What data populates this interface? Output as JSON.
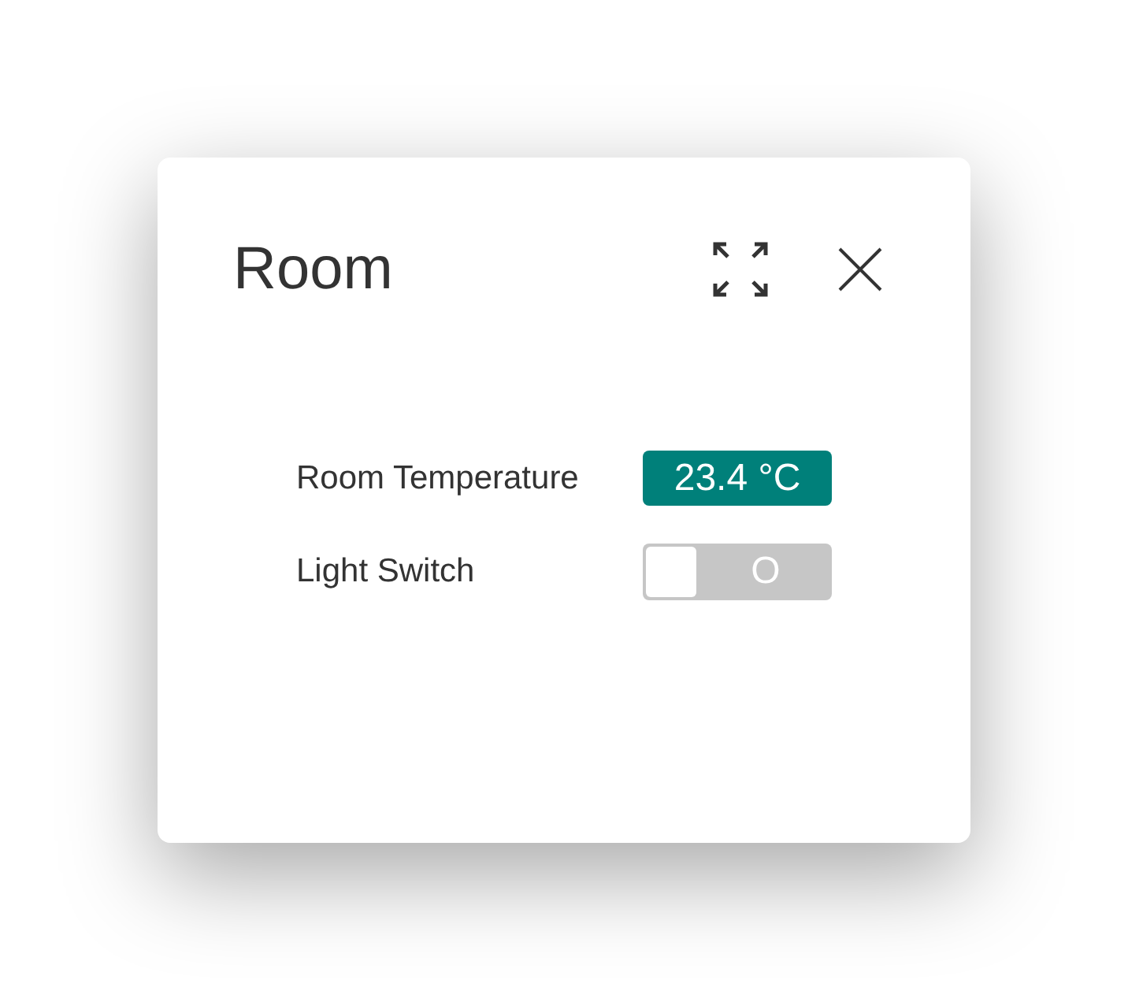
{
  "dialog": {
    "title": "Room"
  },
  "rows": [
    {
      "kind": "value",
      "label": "Room Temperature",
      "value": "23.4 °C"
    },
    {
      "kind": "switch",
      "label": "Light Switch",
      "on": false,
      "value": "O"
    }
  ]
}
